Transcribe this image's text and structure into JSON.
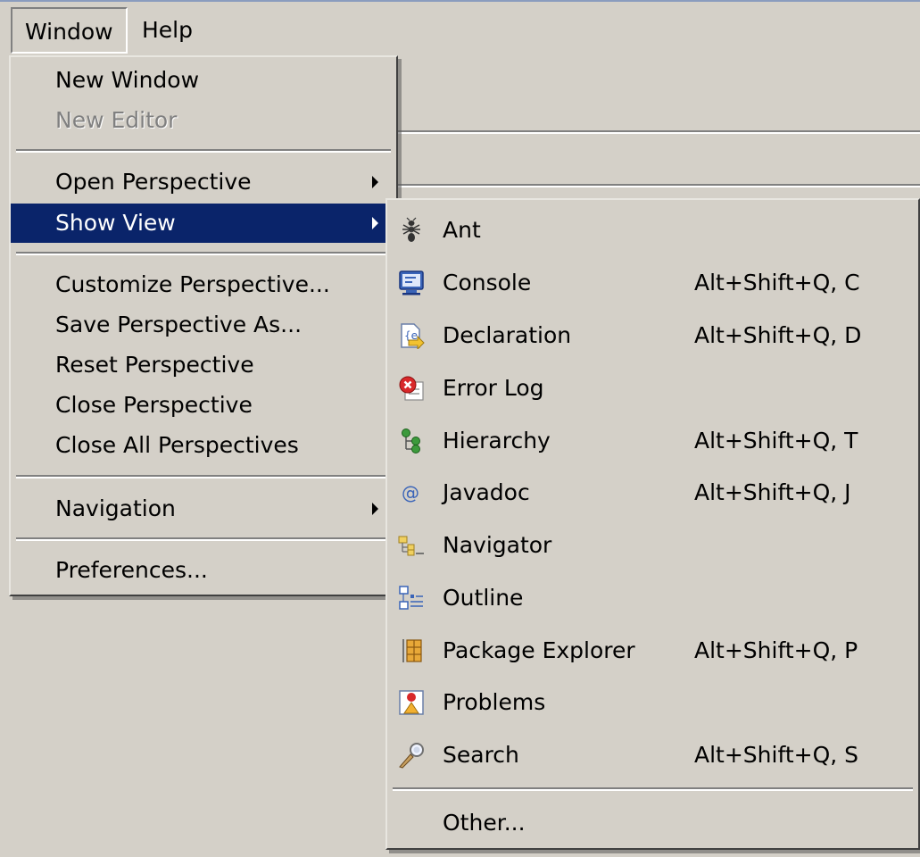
{
  "menubar": {
    "items": [
      {
        "label": "Window"
      },
      {
        "label": "Help"
      }
    ]
  },
  "window_menu": {
    "items": [
      {
        "label": "New Window",
        "enabled": true
      },
      {
        "label": "New Editor",
        "enabled": false
      },
      {
        "label": "Open Perspective",
        "submenu": true
      },
      {
        "label": "Show View",
        "submenu": true,
        "selected": true
      },
      {
        "label": "Customize Perspective..."
      },
      {
        "label": "Save Perspective As..."
      },
      {
        "label": "Reset Perspective"
      },
      {
        "label": "Close Perspective"
      },
      {
        "label": "Close All Perspectives"
      },
      {
        "label": "Navigation",
        "submenu": true
      },
      {
        "label": "Preferences..."
      }
    ]
  },
  "show_view_menu": {
    "items": [
      {
        "label": "Ant",
        "icon": "ant-icon",
        "shortcut": ""
      },
      {
        "label": "Console",
        "icon": "console-icon",
        "shortcut": "Alt+Shift+Q, C"
      },
      {
        "label": "Declaration",
        "icon": "declaration-icon",
        "shortcut": "Alt+Shift+Q, D"
      },
      {
        "label": "Error Log",
        "icon": "error-log-icon",
        "shortcut": ""
      },
      {
        "label": "Hierarchy",
        "icon": "hierarchy-icon",
        "shortcut": "Alt+Shift+Q, T"
      },
      {
        "label": "Javadoc",
        "icon": "javadoc-icon",
        "shortcut": "Alt+Shift+Q, J"
      },
      {
        "label": "Navigator",
        "icon": "navigator-icon",
        "shortcut": ""
      },
      {
        "label": "Outline",
        "icon": "outline-icon",
        "shortcut": ""
      },
      {
        "label": "Package Explorer",
        "icon": "package-explorer-icon",
        "shortcut": "Alt+Shift+Q, P"
      },
      {
        "label": "Problems",
        "icon": "problems-icon",
        "shortcut": ""
      },
      {
        "label": "Search",
        "icon": "search-icon",
        "shortcut": "Alt+Shift+Q, S"
      },
      {
        "label": "Other...",
        "icon": "",
        "shortcut": ""
      }
    ]
  },
  "colors": {
    "menu_background": "#d4d0c8",
    "selection": "#0a246a",
    "disabled_text": "#808080"
  }
}
